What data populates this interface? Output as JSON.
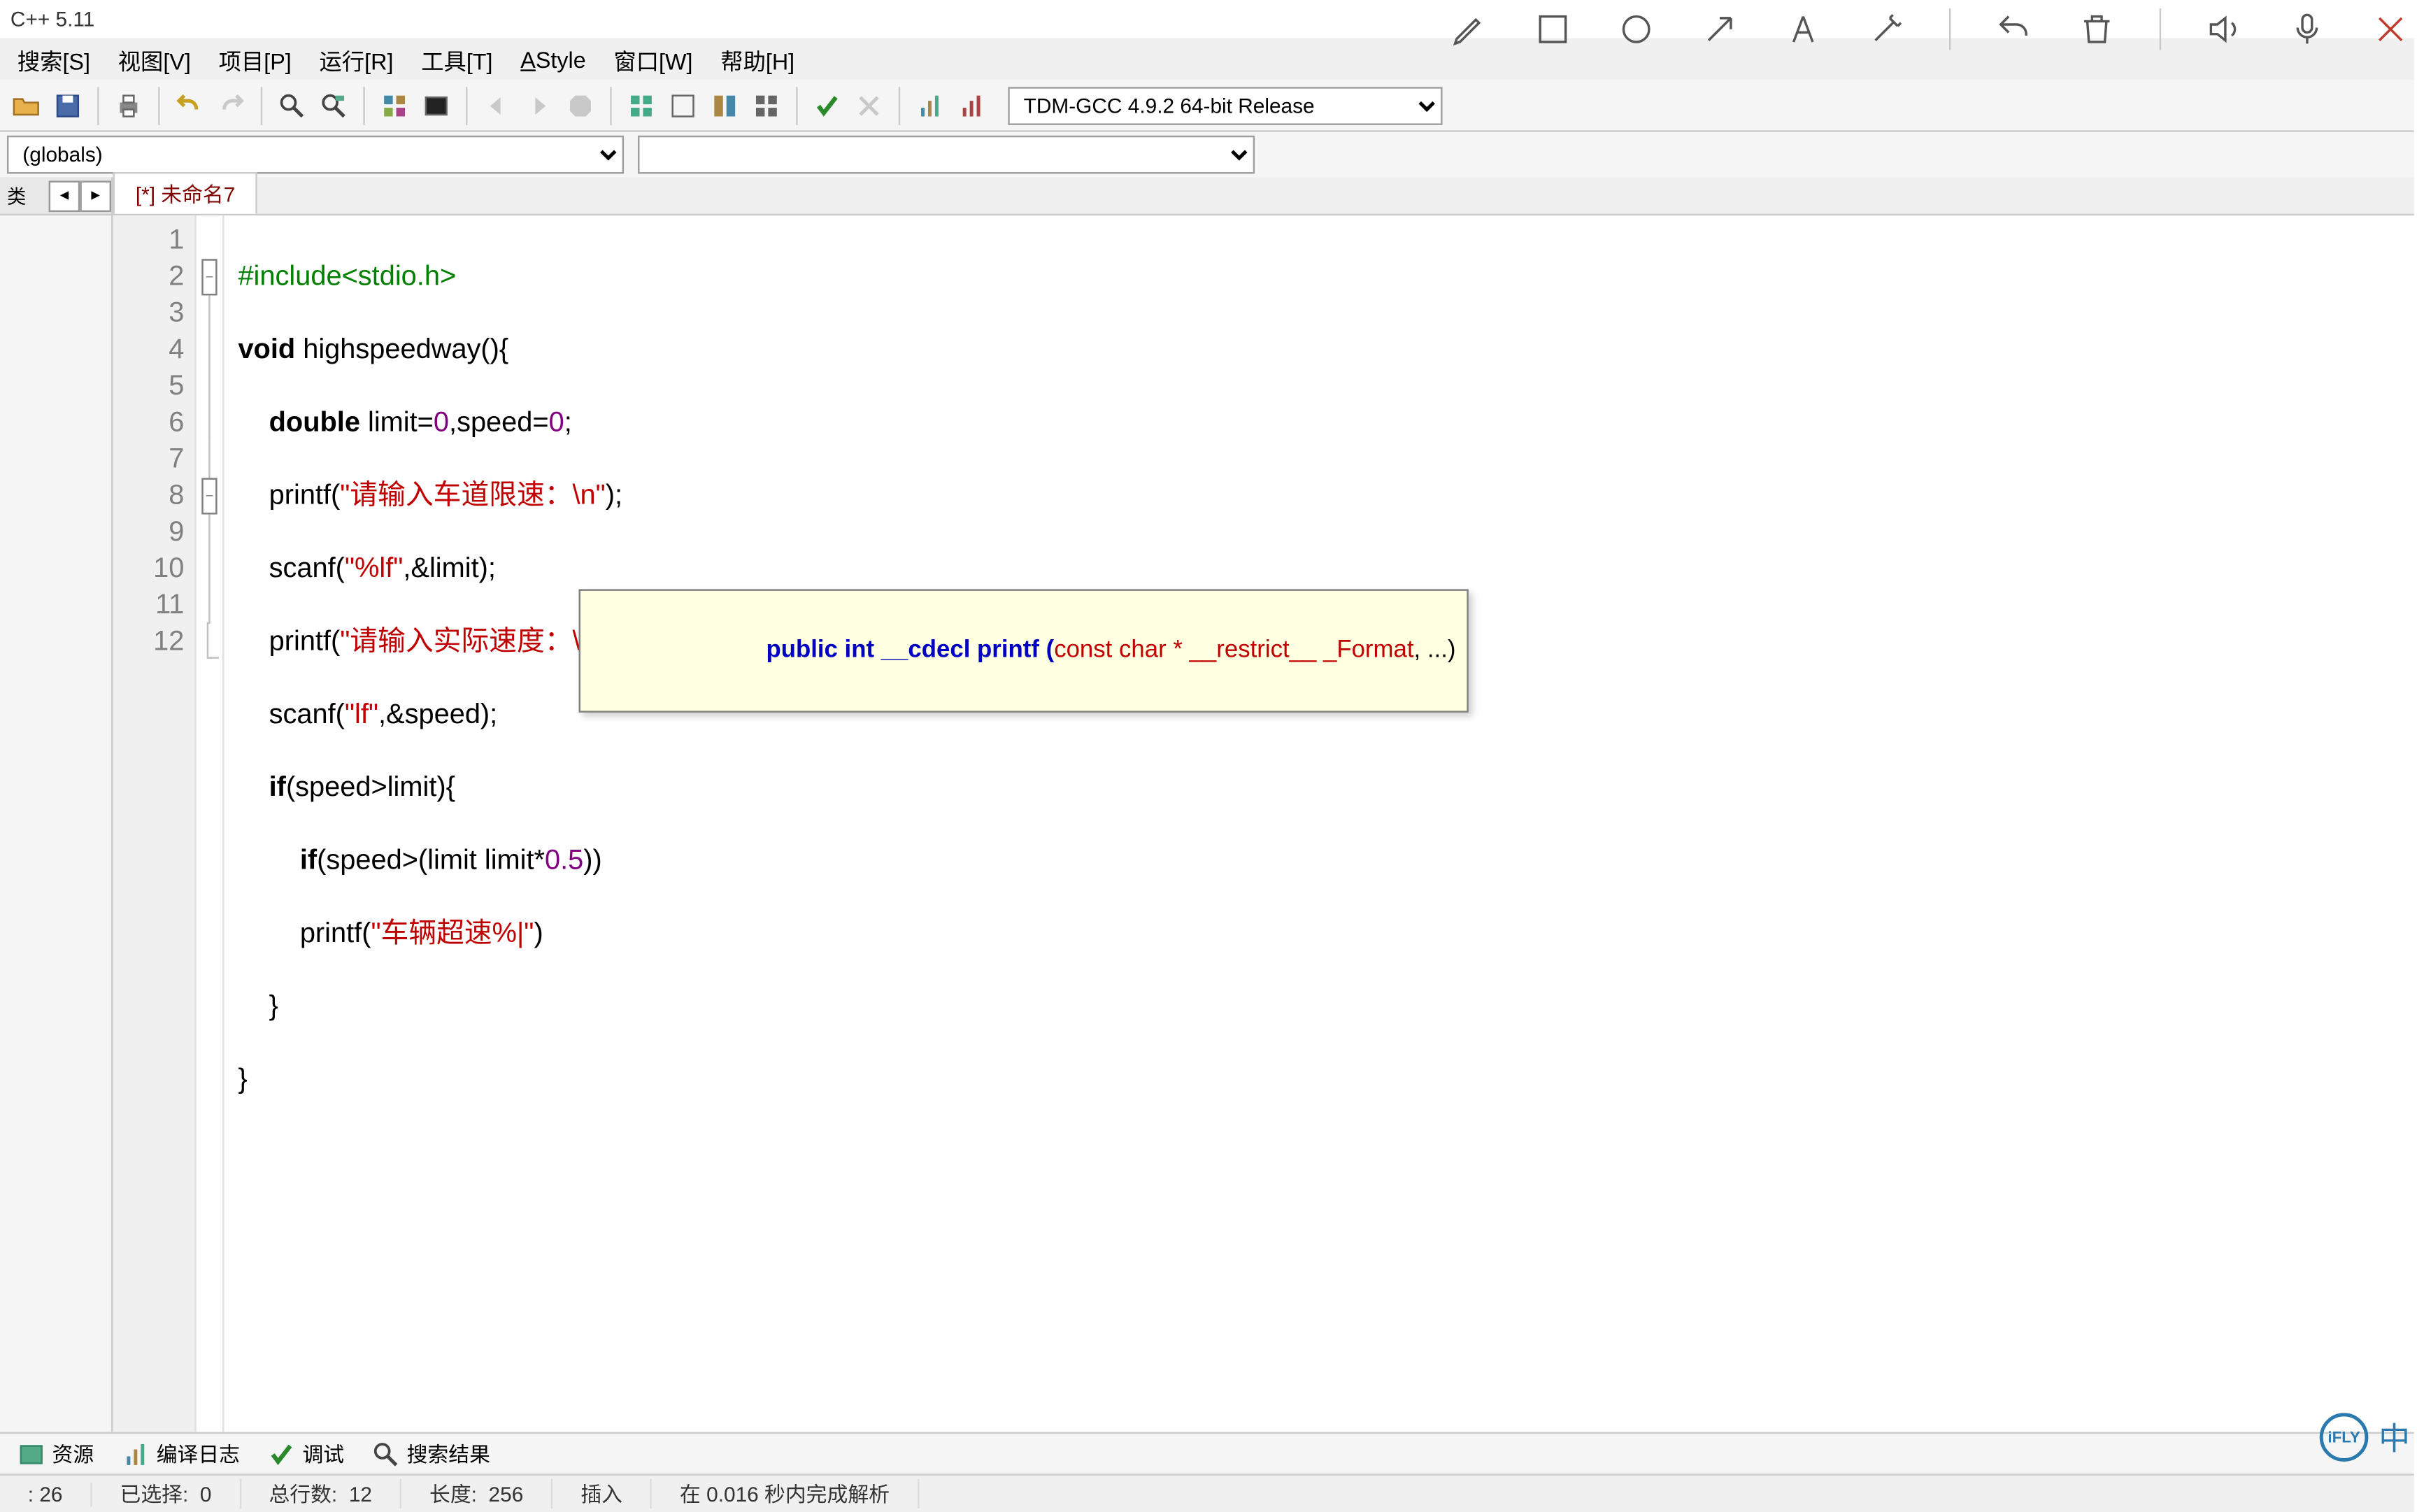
{
  "title": "C++ 5.11",
  "menu": {
    "search": "搜索[S]",
    "view": "视图[V]",
    "project": "项目[P]",
    "run": "运行[R]",
    "tools": "工具[T]",
    "astyle": "AStyle",
    "window": "窗口[W]",
    "help": "帮助[H]"
  },
  "compiler": "TDM-GCC 4.9.2 64-bit Release",
  "scope": "(globals)",
  "side_tab": "类",
  "file_tab": "[*] 未命名7",
  "code": {
    "l1_a": "#include",
    "l1_b": "<stdio.h>",
    "l2_a": "void",
    "l2_b": " highspeedway(){",
    "l3_a": "    ",
    "l3_b": "double",
    "l3_c": " limit=",
    "l3_d": "0",
    "l3_e": ",speed=",
    "l3_f": "0",
    "l3_g": ";",
    "l4_a": "    printf(",
    "l4_b": "\"请输入车道限速：\\n\"",
    "l4_c": ");",
    "l5_a": "    scanf(",
    "l5_b": "\"%lf\"",
    "l5_c": ",&limit);",
    "l6_a": "    printf(",
    "l6_b": "\"请输入实际速度：\\n\"",
    "l6_c": ");",
    "l7_a": "    scanf(",
    "l7_b": "\"lf\"",
    "l7_c": ",&speed);",
    "l8_a": "    ",
    "l8_b": "if",
    "l8_c": "(speed>limit){",
    "l9_a": "        ",
    "l9_b": "if",
    "l9_c": "(speed>(limit limit*",
    "l9_d": "0.5",
    "l9_e": "))",
    "l10_a": "        printf(",
    "l10_b": "\"车辆超速%|\"",
    "l10_c": ")",
    "l11": "    }",
    "l12": "}"
  },
  "tooltip": {
    "t1": "public int __cdecl printf (",
    "t2": "const char * __restrict__ _Format",
    "t3": ", ...)"
  },
  "bottom_tabs": {
    "resources": "资源",
    "compile_log": "编译日志",
    "debug": "调试",
    "search_results": "搜索结果"
  },
  "status": {
    "col": ":   26",
    "sel_label": "已选择:",
    "sel_val": "0",
    "lines_label": "总行数:",
    "lines_val": "12",
    "len_label": "长度:",
    "len_val": "256",
    "mode": "插入",
    "parse": "在 0.016 秒内完成解析"
  },
  "ifly": "iFLY",
  "ime": "中"
}
